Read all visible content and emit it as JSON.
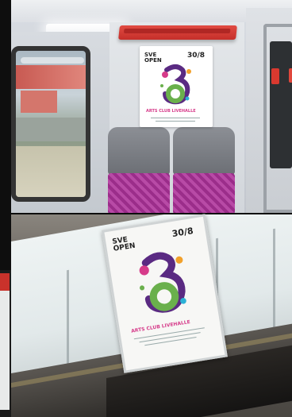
{
  "poster": {
    "logo_line1": "SVE",
    "logo_line2": "OPEN",
    "date": "30/8",
    "subtitle": "ARTS CLUB LIVEHALLE"
  },
  "colors": {
    "seat_fabric": "#9b2d8a",
    "shelf": "#d9392f",
    "poster_accent_pink": "#d63b8a",
    "poster_accent_green": "#6ab04c",
    "poster_accent_purple": "#5a2a82"
  }
}
